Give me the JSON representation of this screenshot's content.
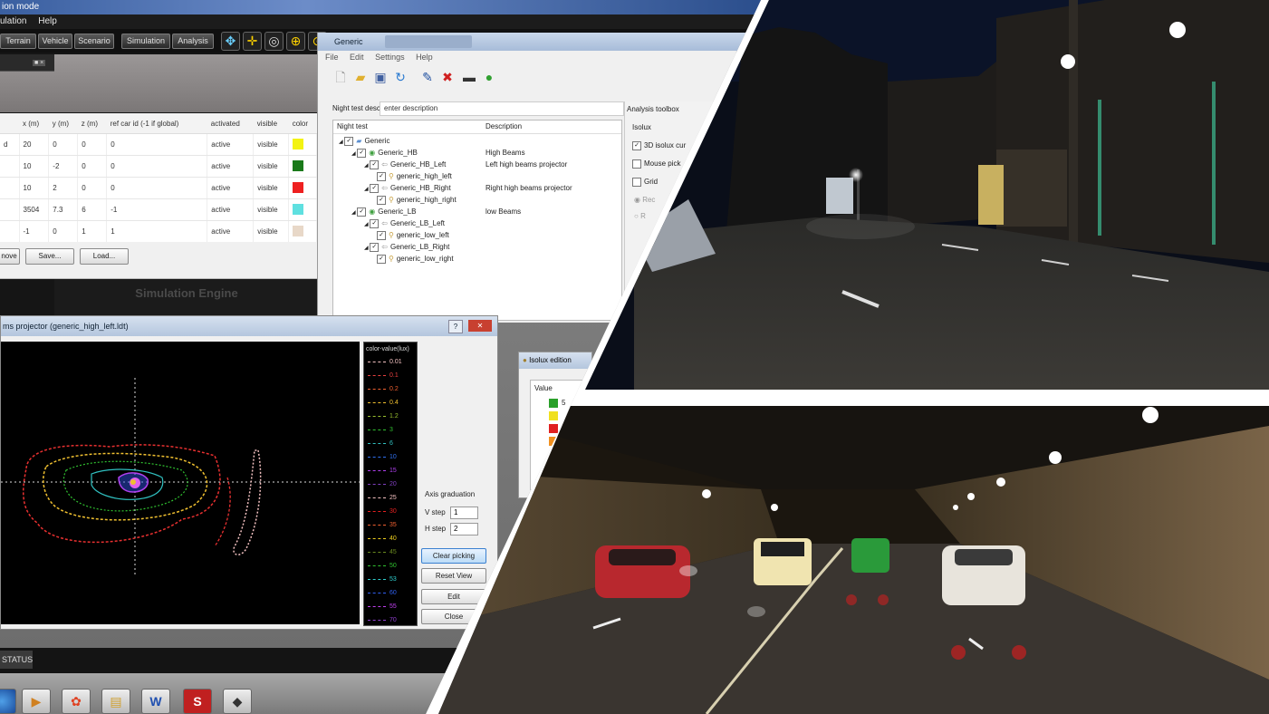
{
  "app": {
    "title_fragment": "ion mode",
    "menu": [
      "ulation",
      "Help"
    ],
    "toolbar_tabs": [
      "Terrain",
      "Vehicle",
      "Scenario",
      "Simulation",
      "Analysis"
    ],
    "panel_badge": "■ ×"
  },
  "car_table": {
    "columns": [
      "x (m)",
      "y (m)",
      "z (m)",
      "ref car id (-1 if global)",
      "activated",
      "visible",
      "color"
    ],
    "row_stub": [
      "d",
      "",
      "",
      "",
      ""
    ],
    "rows": [
      {
        "x": "20",
        "y": "0",
        "z": "0",
        "ref": "0",
        "activated": "active",
        "visible": "visible",
        "color": "#f3f312"
      },
      {
        "x": "10",
        "y": "-2",
        "z": "0",
        "ref": "0",
        "activated": "active",
        "visible": "visible",
        "color": "#1a7a1a"
      },
      {
        "x": "10",
        "y": "2",
        "z": "0",
        "ref": "0",
        "activated": "active",
        "visible": "visible",
        "color": "#ee2020"
      },
      {
        "x": "3504",
        "y": "7.3",
        "z": "6",
        "ref": "-1",
        "activated": "active",
        "visible": "visible",
        "color": "#5fe0e0"
      },
      {
        "x": "-1",
        "y": "0",
        "z": "1",
        "ref": "1",
        "activated": "active",
        "visible": "visible",
        "color": "#e8d8c8"
      }
    ],
    "buttons": [
      "nove",
      "Save...",
      "Load..."
    ]
  },
  "simulation_engine_label": "Simulation Engine",
  "generic_window": {
    "title": "Generic",
    "menu": [
      "File",
      "Edit",
      "Settings",
      "Help"
    ],
    "night_test_label": "Night test description",
    "description_value": "enter description",
    "analysis_toolbox": "Analysis toolbox",
    "tree_headers": [
      "Night test",
      "Description"
    ],
    "tree": [
      {
        "label": "Generic",
        "desc": ""
      },
      {
        "label": "Generic_HB",
        "desc": "High Beams"
      },
      {
        "label": "Generic_HB_Left",
        "desc": "Left high beams projector"
      },
      {
        "label": "generic_high_left",
        "desc": ""
      },
      {
        "label": "Generic_HB_Right",
        "desc": "Right high beams projector"
      },
      {
        "label": "generic_high_right",
        "desc": ""
      },
      {
        "label": "Generic_LB",
        "desc": "low Beams"
      },
      {
        "label": "Generic_LB_Left",
        "desc": ""
      },
      {
        "label": "generic_low_left",
        "desc": ""
      },
      {
        "label": "Generic_LB_Right",
        "desc": ""
      },
      {
        "label": "generic_low_right",
        "desc": ""
      }
    ],
    "toolbox": {
      "isolux": "Isolux",
      "check_3d": "3D isolux cur",
      "check_mouse": "Mouse pick",
      "check_grid": "Grid",
      "radio1": "Rec",
      "radio2": "R"
    }
  },
  "projector_window": {
    "title": "ms projector (generic_high_left.ldt)",
    "legend_title": "color-value(lux)",
    "legend": [
      {
        "v": "0.01",
        "c": "#f2c0c0"
      },
      {
        "v": "0.1",
        "c": "#e84040"
      },
      {
        "v": "0.2",
        "c": "#f06030"
      },
      {
        "v": "0.4",
        "c": "#f0c030"
      },
      {
        "v": "1.2",
        "c": "#9ac030"
      },
      {
        "v": "3",
        "c": "#30c030"
      },
      {
        "v": "6",
        "c": "#30c0c0"
      },
      {
        "v": "10",
        "c": "#3070f0"
      },
      {
        "v": "15",
        "c": "#b040f0"
      },
      {
        "v": "20",
        "c": "#8040c0"
      },
      {
        "v": "25",
        "c": "#f2c0c0"
      },
      {
        "v": "30",
        "c": "#e82020"
      },
      {
        "v": "35",
        "c": "#f06030"
      },
      {
        "v": "40",
        "c": "#f0d020"
      },
      {
        "v": "45",
        "c": "#6a8a20"
      },
      {
        "v": "50",
        "c": "#30c030"
      },
      {
        "v": "53",
        "c": "#30d0d0"
      },
      {
        "v": "60",
        "c": "#3060f0"
      },
      {
        "v": "55",
        "c": "#c040f0"
      },
      {
        "v": "70",
        "c": "#9040d0"
      }
    ],
    "axis_graduation": "Axis graduation",
    "v_step_label": "V step",
    "v_step": "1",
    "h_step_label": "H step",
    "h_step": "2",
    "buttons": [
      "Clear picking",
      "Reset View",
      "Edit",
      "Close"
    ]
  },
  "isolux_window": {
    "title": "Isolux edition",
    "value_header": "Value",
    "row_label": "5"
  },
  "status_tab": "STATUS",
  "taskbar_icons": [
    "windows-orb-icon",
    "explorer-icon",
    "media-icon",
    "folder-icon",
    "word-icon",
    "scaner-icon",
    "app-icon"
  ],
  "taskbar_labels": [
    "W",
    "S"
  ]
}
